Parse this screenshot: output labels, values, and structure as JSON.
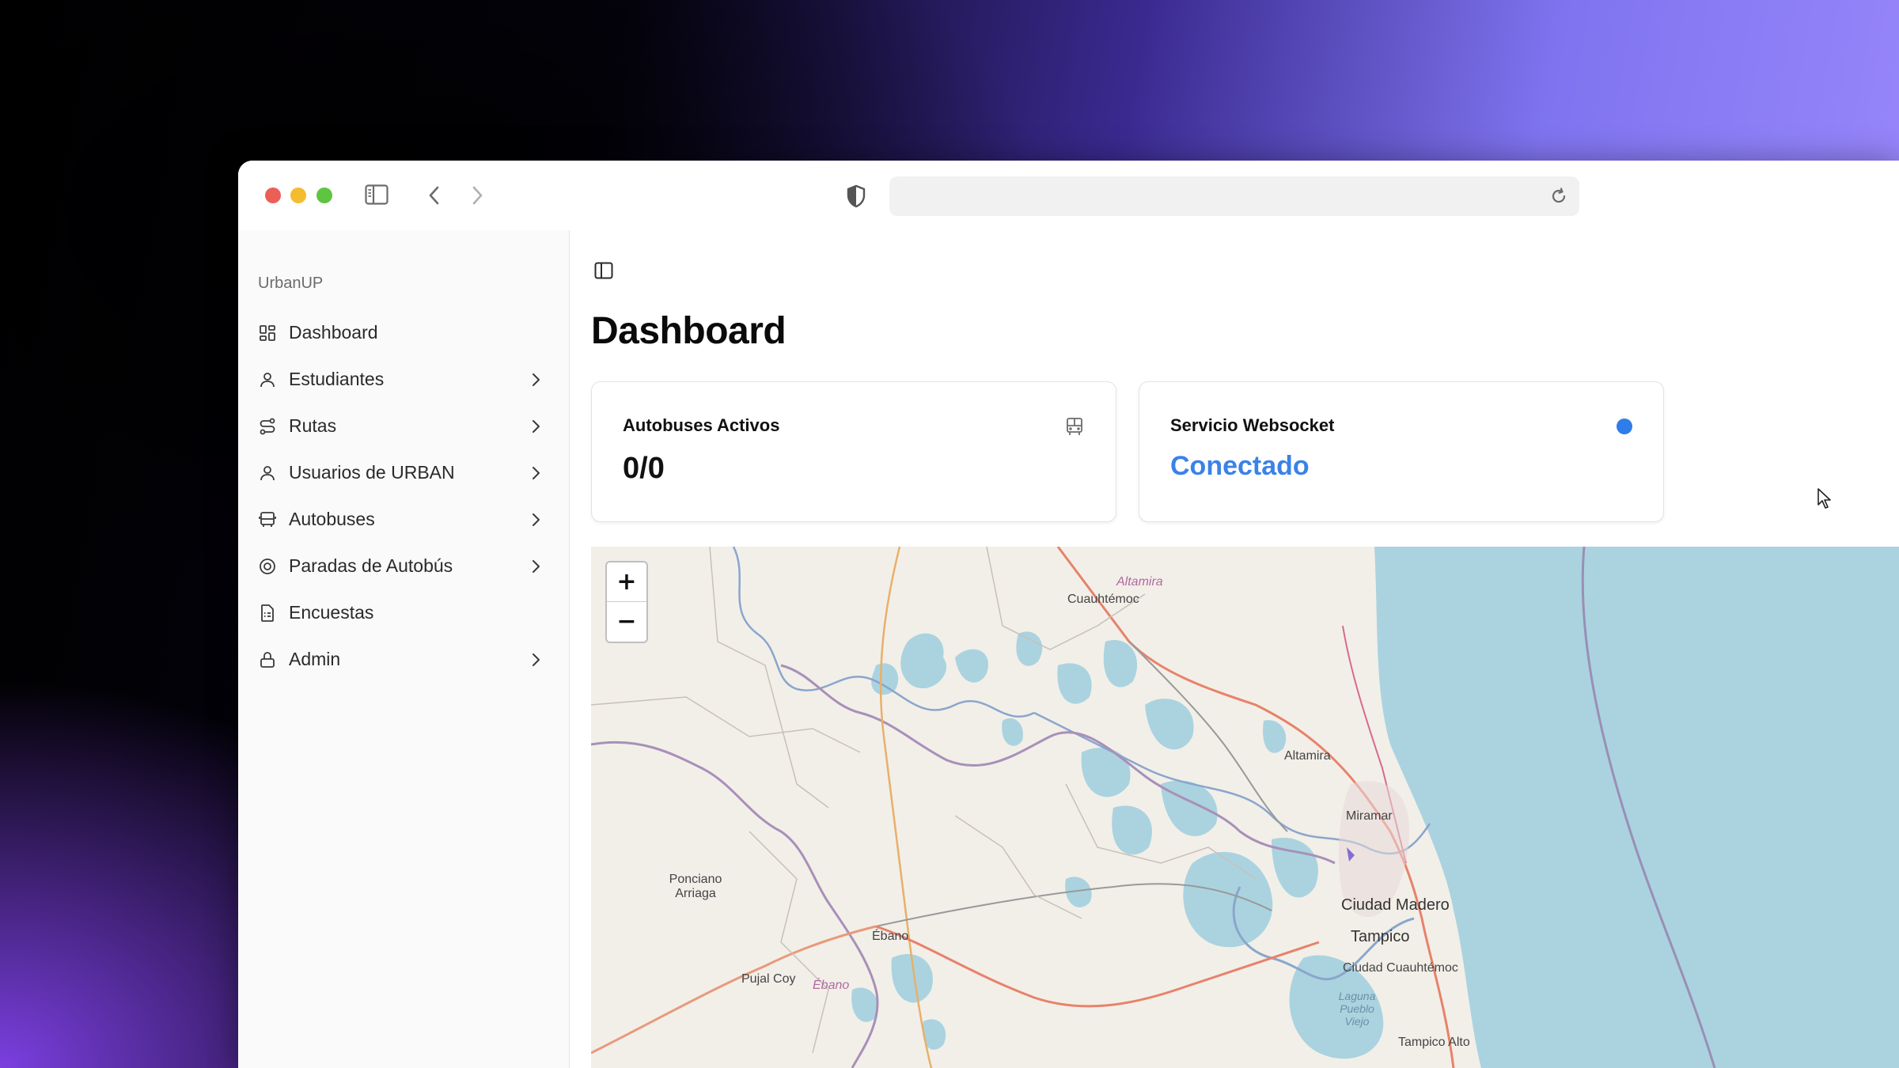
{
  "sidebar": {
    "brand": "UrbanUP",
    "items": [
      {
        "label": "Dashboard"
      },
      {
        "label": "Estudiantes"
      },
      {
        "label": "Rutas"
      },
      {
        "label": "Usuarios de URBAN"
      },
      {
        "label": "Autobuses"
      },
      {
        "label": "Paradas de Autobús"
      },
      {
        "label": "Encuestas"
      },
      {
        "label": "Admin"
      }
    ]
  },
  "main": {
    "title": "Dashboard",
    "cards": [
      {
        "title": "Autobuses Activos",
        "value": "0/0",
        "icon": "bus-icon"
      },
      {
        "title": "Servicio Websocket",
        "value": "Conectado",
        "status_color": "#2f7de8"
      }
    ]
  },
  "map": {
    "zoom_in": "+",
    "zoom_out": "−",
    "labels": [
      "Altamira",
      "Cuauhtémoc",
      "Altamira",
      "Miramar",
      "Ciudad Madero",
      "Tampico",
      "Ciudad Cuauhtémoc",
      "Ponciano Arriaga",
      "Ébano",
      "Pujal Coy",
      "Ébano",
      "Laguna Pueblo Viejo",
      "Tampico Alto"
    ]
  },
  "colors": {
    "accent": "#3b82e8",
    "water": "#aad3df",
    "land": "#f2efe9"
  }
}
